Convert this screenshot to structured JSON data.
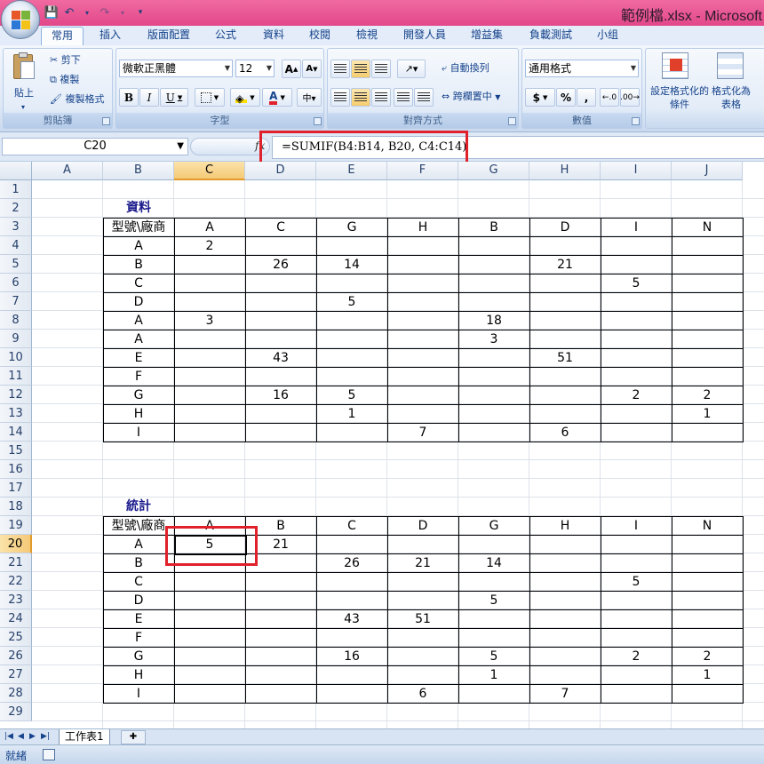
{
  "window": {
    "title": "範例檔.xlsx - Microsoft"
  },
  "ribbon": {
    "tabs": [
      "常用",
      "插入",
      "版面配置",
      "公式",
      "資料",
      "校閱",
      "檢視",
      "開發人員",
      "增益集",
      "負載測試",
      "小组"
    ],
    "active_tab": "常用",
    "clipboard": {
      "title": "剪貼簿",
      "paste": "貼上",
      "cut": "剪下",
      "copy": "複製",
      "format_painter": "複製格式"
    },
    "font": {
      "title": "字型",
      "name": "微軟正黑體",
      "size": "12",
      "bold": "B",
      "italic": "I",
      "underline": "U",
      "grow": "A",
      "shrink": "A"
    },
    "alignment": {
      "title": "對齊方式",
      "wrap": "自動換列",
      "merge": "跨欄置中"
    },
    "number": {
      "title": "數值",
      "format": "通用格式",
      "currency": "$",
      "percent": "%",
      "comma": ","
    },
    "styles": {
      "conditional": "設定格式化的條件",
      "as_table": "格式化為表格"
    }
  },
  "formula_bar": {
    "name_box": "C20",
    "fx": "fx",
    "formula": "=SUMIF(B4:B14, B20, C4:C14)"
  },
  "columns": [
    "A",
    "B",
    "C",
    "D",
    "E",
    "F",
    "G",
    "H",
    "I",
    "J"
  ],
  "selected_column": "C",
  "selected_row": 20,
  "rows": [
    1,
    2,
    3,
    4,
    5,
    6,
    7,
    8,
    9,
    10,
    11,
    12,
    13,
    14,
    15,
    16,
    17,
    18,
    19,
    20,
    21,
    22,
    23,
    24,
    25,
    26,
    27,
    28,
    29
  ],
  "data_section": {
    "label": "資料",
    "header": [
      "型號\\廠商",
      "A",
      "C",
      "G",
      "H",
      "B",
      "D",
      "I",
      "N"
    ],
    "rows": [
      [
        "A",
        "2",
        "",
        "",
        "",
        "",
        "",
        "",
        ""
      ],
      [
        "B",
        "",
        "26",
        "14",
        "",
        "",
        "21",
        "",
        ""
      ],
      [
        "C",
        "",
        "",
        "",
        "",
        "",
        "",
        "5",
        ""
      ],
      [
        "D",
        "",
        "",
        "5",
        "",
        "",
        "",
        "",
        ""
      ],
      [
        "A",
        "3",
        "",
        "",
        "",
        "18",
        "",
        "",
        ""
      ],
      [
        "A",
        "",
        "",
        "",
        "",
        "3",
        "",
        "",
        ""
      ],
      [
        "E",
        "",
        "43",
        "",
        "",
        "",
        "51",
        "",
        ""
      ],
      [
        "F",
        "",
        "",
        "",
        "",
        "",
        "",
        "",
        ""
      ],
      [
        "G",
        "",
        "16",
        "5",
        "",
        "",
        "",
        "2",
        "2"
      ],
      [
        "H",
        "",
        "",
        "1",
        "",
        "",
        "",
        "",
        "1"
      ],
      [
        "I",
        "",
        "",
        "",
        "7",
        "",
        "6",
        "",
        ""
      ]
    ]
  },
  "stats_section": {
    "label": "統計",
    "header": [
      "型號\\廠商",
      "A",
      "B",
      "C",
      "D",
      "G",
      "H",
      "I",
      "N"
    ],
    "rows": [
      [
        "A",
        "5",
        "21",
        "",
        "",
        "",
        "",
        "",
        ""
      ],
      [
        "B",
        "",
        "",
        "26",
        "21",
        "14",
        "",
        "",
        ""
      ],
      [
        "C",
        "",
        "",
        "",
        "",
        "",
        "",
        "5",
        ""
      ],
      [
        "D",
        "",
        "",
        "",
        "",
        "5",
        "",
        "",
        ""
      ],
      [
        "E",
        "",
        "",
        "43",
        "51",
        "",
        "",
        "",
        ""
      ],
      [
        "F",
        "",
        "",
        "",
        "",
        "",
        "",
        "",
        ""
      ],
      [
        "G",
        "",
        "",
        "16",
        "",
        "5",
        "",
        "2",
        "2"
      ],
      [
        "H",
        "",
        "",
        "",
        "",
        "1",
        "",
        "",
        "1"
      ],
      [
        "I",
        "",
        "",
        "",
        "6",
        "",
        "7",
        "",
        ""
      ]
    ]
  },
  "sheet_tabs": {
    "active": "工作表1"
  },
  "status": {
    "text": "就緒"
  }
}
